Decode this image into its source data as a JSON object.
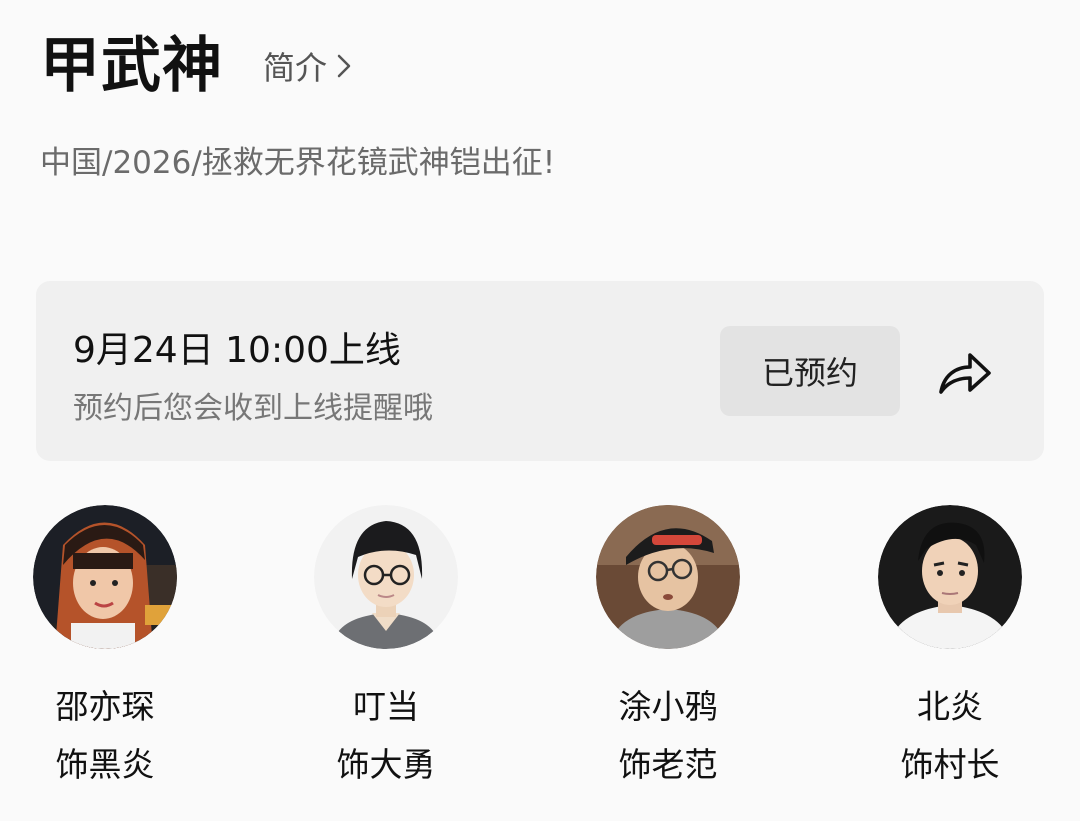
{
  "header": {
    "title": "甲武神",
    "intro_label": "简介",
    "intro_icon": "chevron-right-icon"
  },
  "subtitle": "中国/2026/拯救无界花镜武神铠出征!",
  "release": {
    "time_text": "9月24日 10:00上线",
    "hint_text": "预约后您会收到上线提醒哦",
    "reserve_label": "已预约",
    "share_icon": "share-icon"
  },
  "cast": [
    {
      "name": "邵亦琛",
      "role": "饰黑炎"
    },
    {
      "name": "叮当",
      "role": "饰大勇"
    },
    {
      "name": "涂小鸦",
      "role": "饰老范"
    },
    {
      "name": "北炎",
      "role": "饰村长"
    }
  ],
  "colors": {
    "background": "#fafafa",
    "card": "#f0f0f0",
    "button": "#e3e3e3",
    "primary_text": "#111111",
    "secondary_text": "#777777"
  }
}
